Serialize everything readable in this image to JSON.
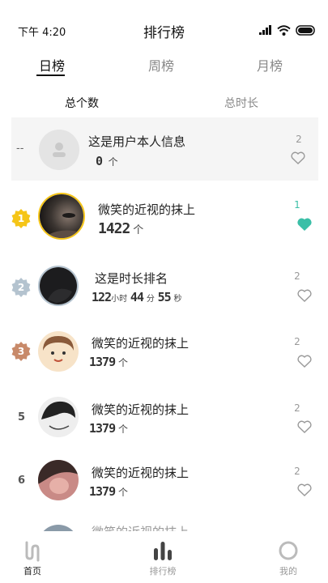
{
  "status": {
    "time": "下午 4:20",
    "title": "排行榜"
  },
  "tabs": [
    {
      "label": "日榜"
    },
    {
      "label": "周榜"
    },
    {
      "label": "月榜"
    }
  ],
  "subtabs": [
    {
      "label": "总个数"
    },
    {
      "label": "总时长"
    }
  ],
  "me": {
    "rank": "--",
    "name": "这是用户本人信息",
    "count": "0",
    "unit": "个",
    "likes": "2"
  },
  "ranking": [
    {
      "rank": "1",
      "name": "微笑的近视的抹上",
      "count": "1422",
      "unit": "个",
      "likes": "1",
      "liked": true
    },
    {
      "rank": "2",
      "name": "这是时长排名",
      "h": "122",
      "h_unit": "小时",
      "m": "44",
      "m_unit": "分",
      "s": "55",
      "s_unit": "秒",
      "likes": "2"
    },
    {
      "rank": "3",
      "name": "微笑的近视的抹上",
      "count": "1379",
      "unit": "个",
      "likes": "2"
    },
    {
      "rank": "5",
      "name": "微笑的近视的抹上",
      "count": "1379",
      "unit": "个",
      "likes": "2"
    },
    {
      "rank": "6",
      "name": "微笑的近视的抹上",
      "count": "1379",
      "unit": "个",
      "likes": "2"
    },
    {
      "name": "微笑的近视的抹上"
    }
  ],
  "nav": [
    {
      "label": "首页"
    },
    {
      "label": "排行榜"
    },
    {
      "label": "我的"
    }
  ],
  "colors": {
    "gold": "#f5c518",
    "silver": "#b4c3cf",
    "bronze": "#c88a6a",
    "accent": "#3bbfa7"
  }
}
